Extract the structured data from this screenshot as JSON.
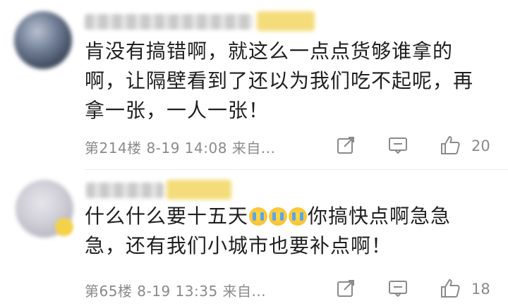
{
  "comments": [
    {
      "text": "肯没有搞错啊，就这么一点点货够谁拿的啊，让隔壁看到了还以为我们吃不起呢，再拿一张，一人一张！",
      "lines": [
        "肯没有搞错啊，就这么一点点货够谁拿的",
        "啊，让隔壁看到了还以为我们吃不起呢，再",
        "拿一张，一人一张！"
      ],
      "floor_time": "第214楼 8-19 14:08 来自...",
      "likes": "20"
    },
    {
      "text_before_emoji": "什么什么要十五天",
      "text_after_emoji": "你搞快点啊急急",
      "line2": "急，还有我们小城市也要补点啊！",
      "emojis": [
        "crying-emoji",
        "crying-emoji",
        "crying-emoji"
      ],
      "floor_time": "第65楼 8-19 13:35 来自...",
      "likes": "18"
    }
  ],
  "icons": {
    "share": "share-icon",
    "reply": "comment-icon",
    "like": "thumbs-up-icon"
  }
}
